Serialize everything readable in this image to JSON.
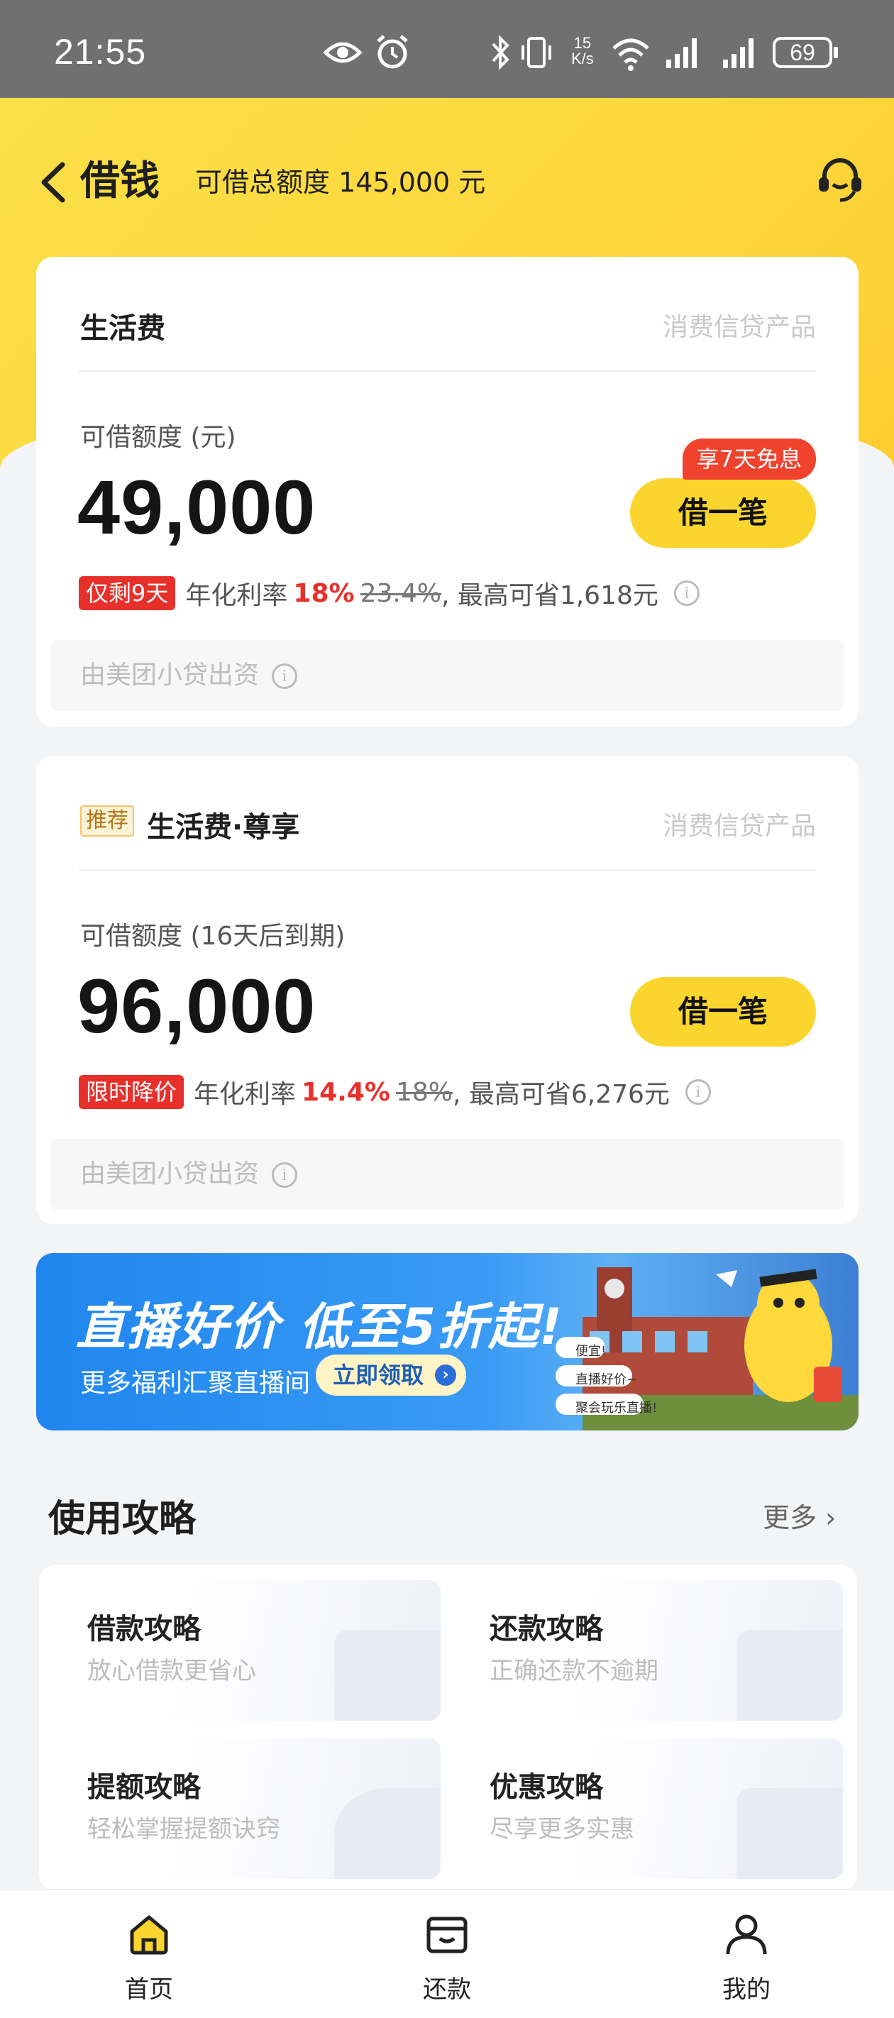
{
  "status_bar": {
    "time": "21:55",
    "net_speed_value": "15",
    "net_speed_unit": "K/s",
    "battery": "69"
  },
  "header": {
    "title": "借钱",
    "total_credit": "可借总额度 145,000 元"
  },
  "card1": {
    "name": "生活费",
    "product_tag": "消费信贷产品",
    "amount_label": "可借额度 (元)",
    "amount": "49,000",
    "promo_badge": "享7天免息",
    "borrow_button": "借一笔",
    "urgency_tag": "仅剩9天",
    "rate_label": "年化利率",
    "rate": "18%",
    "old_rate": "23.4%",
    "saving": ", 最高可省1,618元",
    "funder": "由美团小贷出资"
  },
  "card2": {
    "recommend_tag": "推荐",
    "name": "生活费·尊享",
    "product_tag": "消费信贷产品",
    "amount_label": "可借额度 (16天后到期)",
    "amount": "96,000",
    "borrow_button": "借一笔",
    "urgency_tag": "限时降价",
    "rate_label": "年化利率",
    "rate": "14.4%",
    "old_rate": "18%",
    "saving": ", 最高可省6,276元",
    "funder": "由美团小贷出资"
  },
  "banner": {
    "headline": "直播好价 低至5折起!",
    "subline": "更多福利汇聚直播间",
    "cta": "立即领取",
    "bubbles": [
      "便宜!",
      "直播好价~",
      "聚会玩乐直播!"
    ]
  },
  "guides": {
    "title": "使用攻略",
    "more": "更多",
    "items": [
      {
        "title": "借款攻略",
        "subtitle": "放心借款更省心"
      },
      {
        "title": "还款攻略",
        "subtitle": "正确还款不逾期"
      },
      {
        "title": "提额攻略",
        "subtitle": "轻松掌握提额诀窍"
      },
      {
        "title": "优惠攻略",
        "subtitle": "尽享更多实惠"
      }
    ]
  },
  "tabbar": {
    "items": [
      {
        "label": "首页"
      },
      {
        "label": "还款"
      },
      {
        "label": "我的"
      }
    ]
  },
  "colors": {
    "brand_yellow": "#fad52d",
    "accent_red": "#e8302b",
    "banner_blue": "#1f86ee"
  }
}
